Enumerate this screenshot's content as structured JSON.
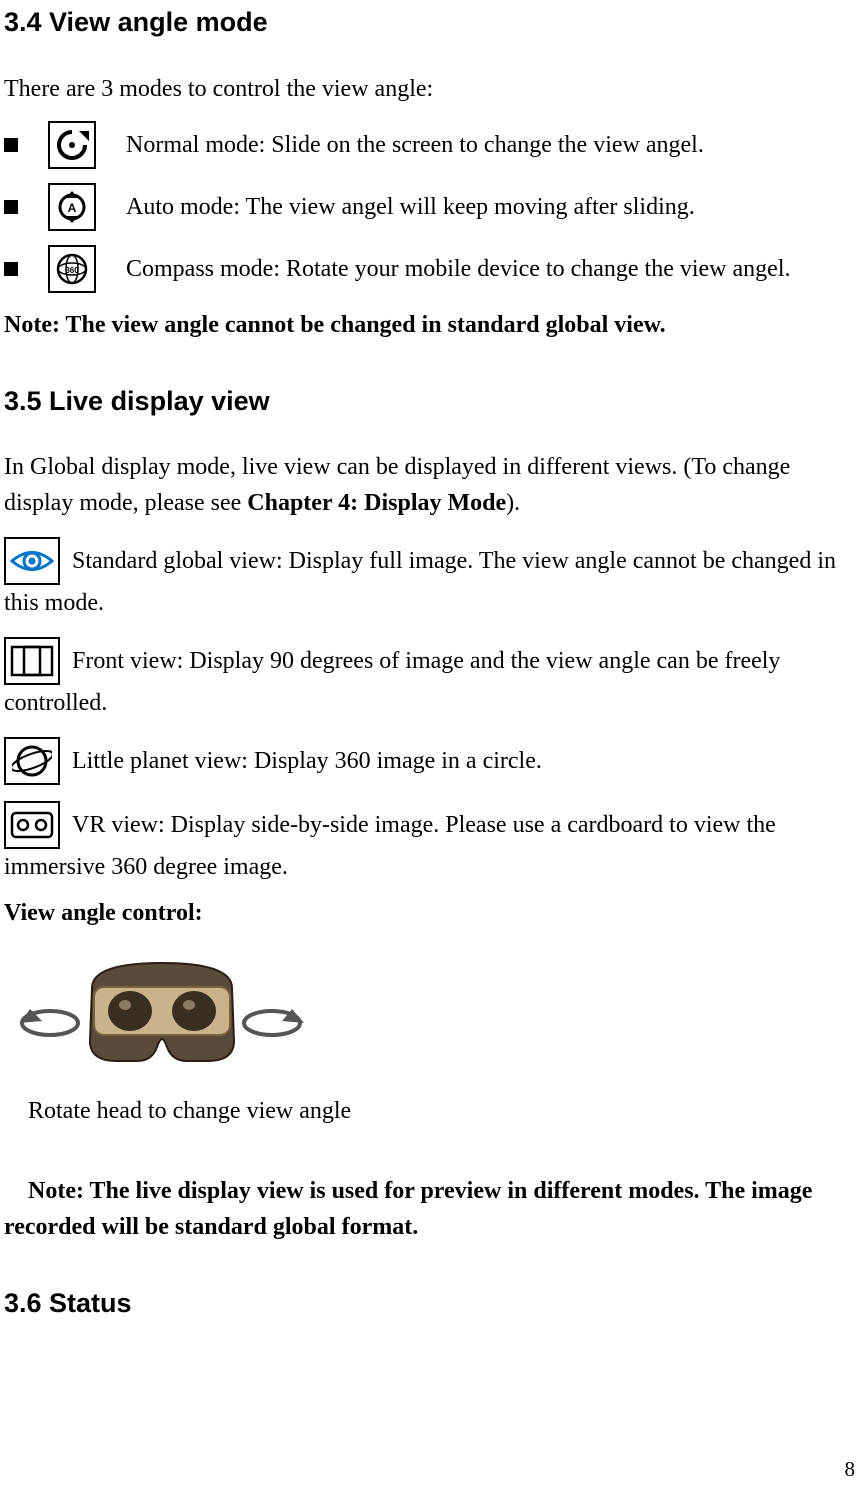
{
  "sections": {
    "s34": {
      "title": "3.4 View angle mode"
    },
    "s35": {
      "title": "3.5 Live display view"
    },
    "s36": {
      "title": "3.6 Status"
    }
  },
  "view_angle": {
    "intro": "There are 3 modes to control the view angle:",
    "modes": [
      {
        "label": "Normal mode: Slide on the screen to change the view angel."
      },
      {
        "label": "Auto mode: The view angel will keep moving after sliding."
      },
      {
        "label": "Compass mode: Rotate your mobile device to change the view angel."
      }
    ],
    "note": "Note: The view angle cannot be changed in standard global view."
  },
  "live_display": {
    "intro1": "In Global display mode, live view can be displayed in different views. (To change ",
    "intro2a": "display mode, please see ",
    "intro2b": "Chapter 4: Display Mode",
    "intro2c": ").",
    "items": [
      {
        "lead": "Standard global view: Display full image. The view angle cannot be changed in ",
        "trail": "this mode."
      },
      {
        "lead": "Front view: Display 90 degrees of image and the view angle can be freely ",
        "trail": "controlled."
      },
      {
        "lead": "Little planet view: Display 360 image in a circle.",
        "trail": ""
      },
      {
        "lead": "VR view: Display side-by-side image. Please use a cardboard to view the ",
        "trail": "immersive 360 degree image."
      }
    ],
    "control_heading": "View angle control:",
    "control_caption": "Rotate head to change view angle",
    "note_line1_indent": "Note: The live display view is used for preview in different modes. The image ",
    "note_line2": "recorded will be standard global format."
  },
  "page_number": "8"
}
